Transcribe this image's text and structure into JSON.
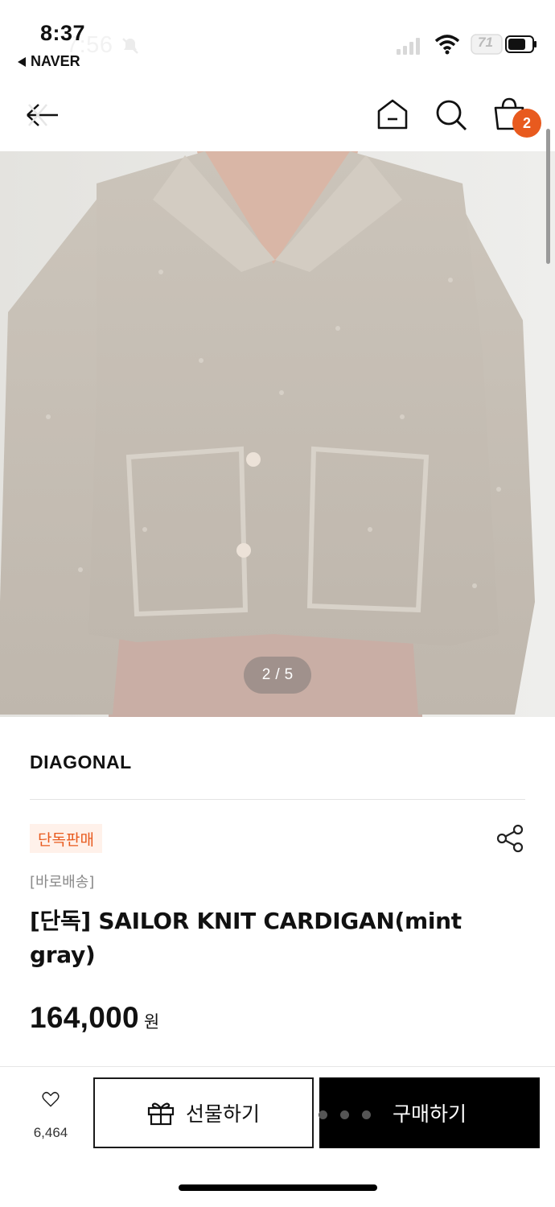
{
  "status_bar": {
    "time": "8:37",
    "time_overlay": "7:56",
    "back_app_label": "NAVER",
    "battery": "71"
  },
  "header": {
    "cart_count": "2",
    "icons": [
      "close-back-icon",
      "home-icon",
      "search-icon",
      "cart-icon"
    ]
  },
  "gallery": {
    "pager_current": "2",
    "pager_separator": "/",
    "pager_total": "5"
  },
  "product": {
    "brand": "DIAGONAL",
    "badge": "단독판매",
    "delivery": "[바로배송]",
    "title": "[단독] SAILOR KNIT CARDIGAN(mint gray)",
    "price": "164,000",
    "price_unit": "원"
  },
  "actions": {
    "wish_count": "6,464",
    "gift_label": "선물하기",
    "buy_label": "구매하기"
  },
  "colors": {
    "accent": "#e85a1e",
    "badge_bg": "#fff1ea",
    "buy_bg": "#000000"
  }
}
